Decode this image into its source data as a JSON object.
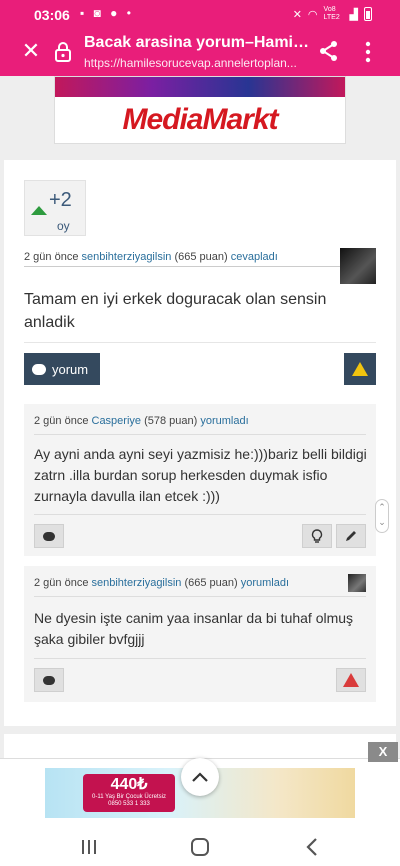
{
  "status_bar": {
    "time": "03:06",
    "network": "Vo8 LTE2"
  },
  "browser": {
    "title": "Bacak arasina yorum–Hamil...",
    "url": "https://hamilesorucevap.annelertoplan..."
  },
  "top_ad": {
    "brand": "MediaMarkt"
  },
  "answer": {
    "vote_score": "+2",
    "vote_label": "oy",
    "time_ago": "2 gün önce",
    "author": "senbihterziyagilsin",
    "points": "(665 puan)",
    "action": "cevapladı",
    "text": "Tamam en iyi erkek doguracak olan sensin anladik",
    "comment_button": "yorum"
  },
  "comments": [
    {
      "time_ago": "2 gün önce",
      "author": "Casperiye",
      "points": "(578 puan)",
      "action": "yorumladı",
      "text": "Ay ayni anda ayni seyi yazmisiz he:)))bariz belli bildigi zatrn .illa burdan sorup herkesden duymak isfio  zurnayla davulla ilan etcek :)))"
    },
    {
      "time_ago": "2 gün önce",
      "author": "senbihterziyagilsin",
      "points": "(665 puan)",
      "action": "yorumladı",
      "text": "Ne dyesin işte canim yaa insanlar da bi tuhaf olmuş şaka gibiler bvfgjjj"
    }
  ],
  "bottom_ad": {
    "close_label": "X",
    "promo_price": "440₺",
    "promo_line": "0-11 Yaş Bir Çocuk Ücretsiz",
    "phone": "0850 533 1 333"
  },
  "colors": {
    "accent": "#e91e7a",
    "button_dark": "#34495e",
    "link": "#2a6f9c",
    "upvote": "#2e9b3f"
  }
}
